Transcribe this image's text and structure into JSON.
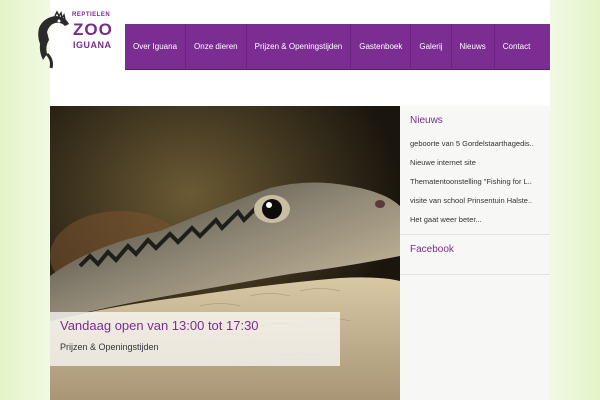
{
  "logo": {
    "line1": "REPTIELEN",
    "line2": "ZOO",
    "line3": "IGUANA"
  },
  "nav": {
    "items": [
      {
        "label": "Over Iguana"
      },
      {
        "label": "Onze dieren"
      },
      {
        "label": "Prijzen & Openingstijden"
      },
      {
        "label": "Gastenboek"
      },
      {
        "label": "Galerij"
      },
      {
        "label": "Nieuws"
      },
      {
        "label": "Contact"
      }
    ]
  },
  "hero": {
    "title": "Vandaag open van 13:00 tot 17:30",
    "subtitle": "Prijzen & Openingstijden"
  },
  "sidebar": {
    "news_heading": "Nieuws",
    "news_items": [
      {
        "label": "geboorte van 5 Gordelstaarthagedis.."
      },
      {
        "label": "Nieuwe internet site"
      },
      {
        "label": "Thematentoonstelling \"Fishing for L.."
      },
      {
        "label": "visite van school Prinsentuin Halste.."
      },
      {
        "label": "Het gaat weer beter..."
      }
    ],
    "facebook_heading": "Facebook"
  },
  "colors": {
    "brand": "#7b2d91",
    "background": "#f1f9e3"
  }
}
